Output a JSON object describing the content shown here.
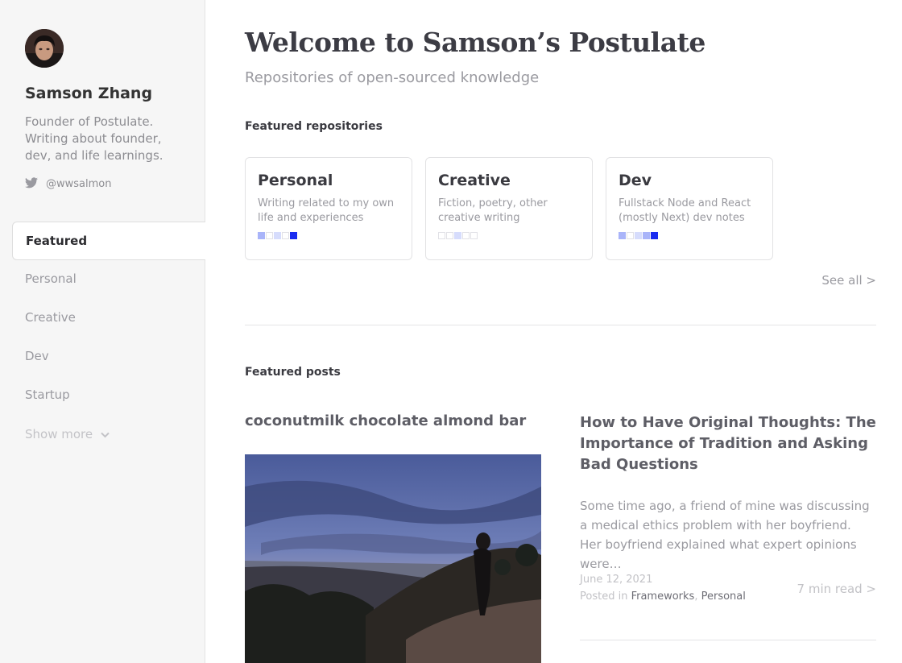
{
  "sidebar": {
    "name": "Samson Zhang",
    "bio": "Founder of Postulate. Writing about founder, dev, and life learnings.",
    "twitter_icon": "twitter-icon",
    "twitter_handle": "@wwsalmon",
    "nav": [
      {
        "label": "Featured",
        "active": true
      },
      {
        "label": "Personal"
      },
      {
        "label": "Creative"
      },
      {
        "label": "Dev"
      },
      {
        "label": "Startup"
      }
    ],
    "show_more_label": "Show more",
    "show_more_icon": "chevron-down-icon"
  },
  "main": {
    "title": "Welcome to Samson’s Postulate",
    "subtitle": "Repositories of open-sourced knowledge",
    "featured_repos_label": "Featured repositories",
    "repos": [
      {
        "name": "Personal",
        "description": "Writing related to my own life and experiences",
        "activity": [
          2,
          0,
          1,
          0,
          3
        ]
      },
      {
        "name": "Creative",
        "description": "Fiction, poetry, other creative writing",
        "activity": [
          0,
          0,
          1,
          0,
          0
        ]
      },
      {
        "name": "Dev",
        "description": "Fullstack Node and React (mostly Next) dev notes",
        "activity": [
          2,
          0,
          1,
          2,
          3
        ]
      }
    ],
    "see_all_label": "See all >",
    "featured_posts_label": "Featured posts",
    "posts": [
      {
        "title": "coconutmilk chocolate almond bar"
      },
      {
        "title": "How to Have Original Thoughts: The Importance of Tradition and Asking Bad Questions",
        "excerpt": "Some time ago, a friend of mine was discussing a medical ethics problem with her boyfriend. Her boyfriend explained what expert opinions were…",
        "date": "June 12, 2021",
        "posted_in_label": "Posted in",
        "tags": [
          "Frameworks",
          "Personal"
        ],
        "read_time": "7 min read >"
      }
    ]
  },
  "colors": {
    "accent": "#1a2cf0",
    "activity_levels": [
      "#ffffff",
      "#d6dcfc",
      "#a9b4f9",
      "#1a2cf0"
    ]
  }
}
